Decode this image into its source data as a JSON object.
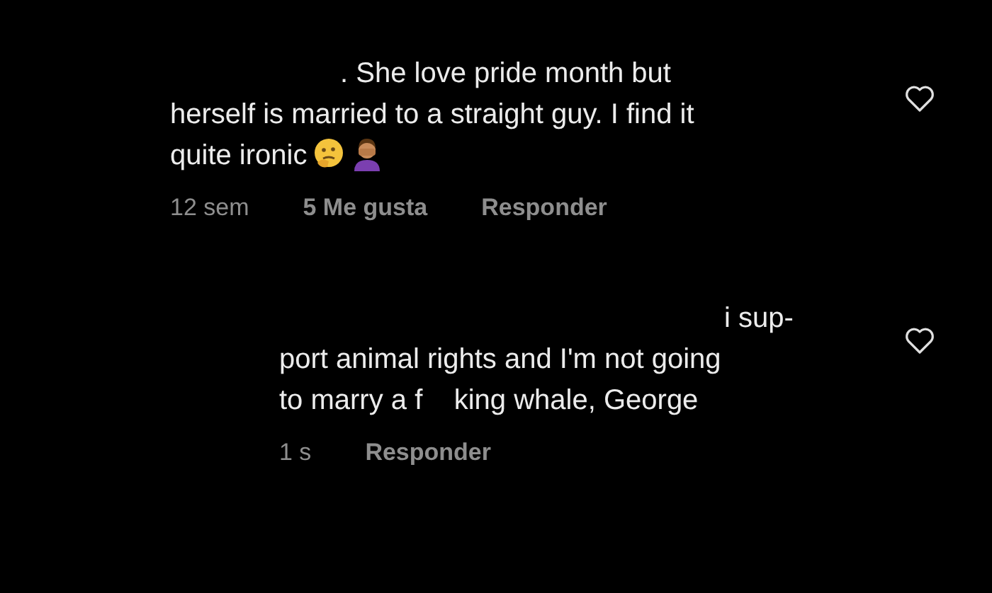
{
  "comments": [
    {
      "kind": "emoji",
      "reply": false,
      "lines": [
        ". She love pride month but",
        "herself is married to a straight guy. I find it",
        "quite ironic"
      ],
      "time": "12 sem",
      "likes": "5 Me gusta",
      "reply_label": "Responder",
      "liked": false
    },
    {
      "kind": "plain",
      "reply": true,
      "lines": [
        "i sup-",
        "port animal rights and I'm not going",
        "to marry a f    king whale, George"
      ],
      "time": "1 s",
      "reply_label": "Responder",
      "liked": false
    }
  ]
}
